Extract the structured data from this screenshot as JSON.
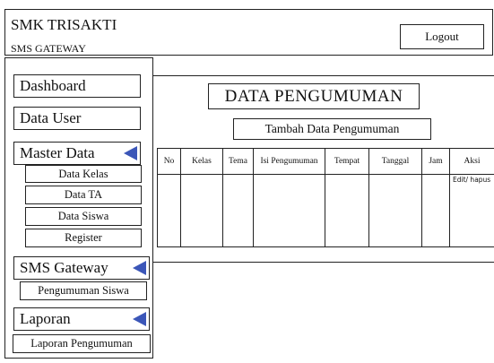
{
  "header": {
    "title": "SMK TRISAKTI",
    "subtitle": "SMS GATEWAY",
    "logout_label": "Logout"
  },
  "sidebar": {
    "dashboard": "Dashboard",
    "data_user": "Data User",
    "master_data": "Master Data",
    "master_items": [
      "Data Kelas",
      "Data TA",
      "Data Siswa",
      "Register"
    ],
    "sms_gateway": "SMS Gateway",
    "sms_items": [
      "Pengumuman Siswa"
    ],
    "laporan": "Laporan",
    "laporan_items": [
      "Laporan Pengumuman"
    ]
  },
  "main": {
    "title": "DATA PENGUMUMAN",
    "add_button": "Tambah Data Pengumuman",
    "table": {
      "columns": [
        "No",
        "Kelas",
        "Tema",
        "Isi Pengumuman",
        "Tempat",
        "Tanggal",
        "Jam",
        "Aksi"
      ],
      "action_text": "Edit/ hapus"
    }
  },
  "colors": {
    "accent_arrow": "#3b56b8",
    "border": "#222222"
  }
}
